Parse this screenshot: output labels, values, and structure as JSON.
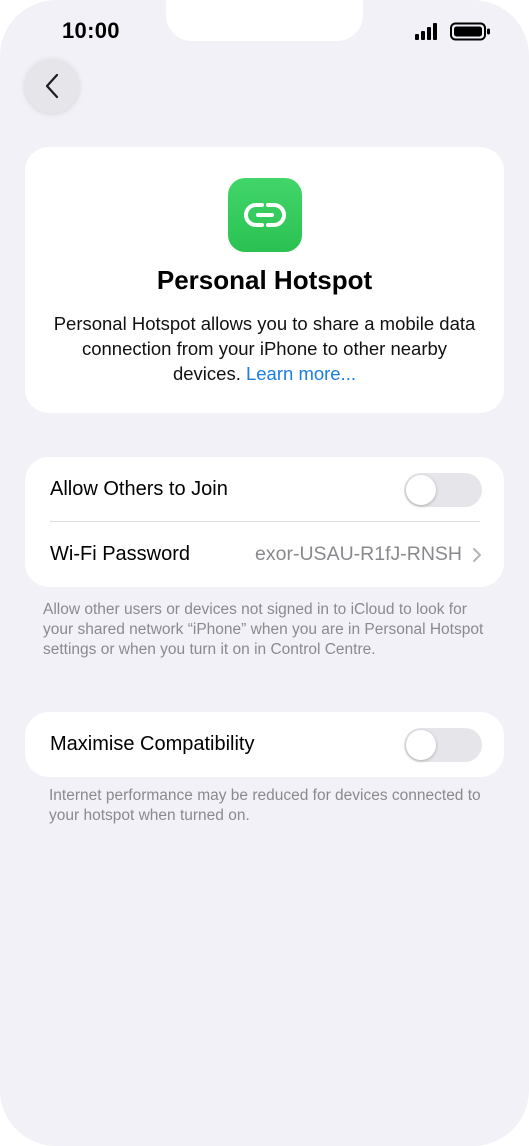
{
  "status_bar": {
    "time": "10:00"
  },
  "nav": {
    "back_icon": "chevron-left-icon"
  },
  "hero": {
    "icon": "link-chain-icon",
    "title": "Personal Hotspot",
    "description": "Personal Hotspot allows you to share a mobile data connection from your iPhone to other nearby devices.",
    "link_text": "Learn more..."
  },
  "settings": {
    "allow_others": {
      "label": "Allow Others to Join",
      "enabled": false
    },
    "wifi_password": {
      "label": "Wi-Fi Password",
      "value": "exor-USAU-R1fJ-RNSH"
    }
  },
  "footnote_allow": "Allow other users or devices not signed in to iCloud to look for your shared network “iPhone” when you are in Personal Hotspot settings or when you turn it on in Control Centre.",
  "compatibility": {
    "label": "Maximise Compatibility",
    "enabled": false
  },
  "footnote_compat": "Internet performance may be reduced for devices connected to your hotspot when turned on.",
  "colors": {
    "accent": "#1a7fe0",
    "icon_green": "#34c759",
    "background": "#f2f1f7"
  }
}
